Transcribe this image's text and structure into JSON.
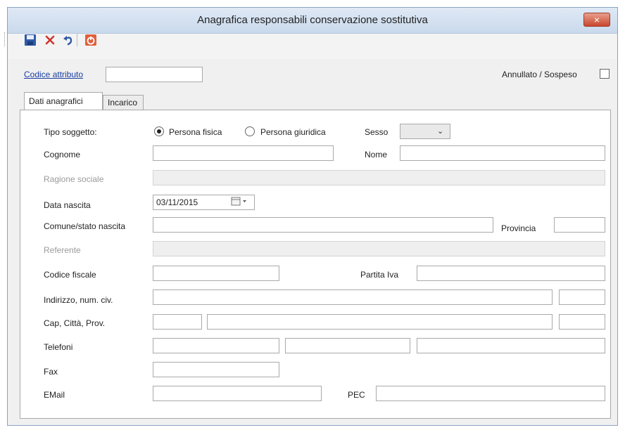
{
  "window": {
    "title": "Anagrafica responsabili conservazione sostitutiva",
    "close_label": "×"
  },
  "toolbar": {
    "icons": [
      "save-icon",
      "delete-icon",
      "undo-icon",
      "exit-icon"
    ]
  },
  "header": {
    "codice_attributo_label": "Codice attributo",
    "codice_attributo_value": "",
    "annullato_label": "Annullato / Sospeso",
    "annullato_checked": false
  },
  "tabs": {
    "items": [
      {
        "label": "Dati anagrafici",
        "active": true
      },
      {
        "label": "Incarico",
        "active": false
      }
    ]
  },
  "form": {
    "tipo_soggetto_label": "Tipo soggetto:",
    "radio_persona_fisica": "Persona fisica",
    "radio_persona_giuridica": "Persona giuridica",
    "selected_tipo": "Persona fisica",
    "sesso_label": "Sesso",
    "sesso_value": "",
    "cognome_label": "Cognome",
    "nome_label": "Nome",
    "ragione_sociale_label": "Ragione sociale",
    "data_nascita_label": "Data nascita",
    "data_nascita_value": "03/11/2015",
    "comune_label": "Comune/stato nascita",
    "provincia_label": "Provincia",
    "referente_label": "Referente",
    "codice_fiscale_label": "Codice fiscale",
    "partita_iva_label": "Partita Iva",
    "indirizzo_label": "Indirizzo, num. civ.",
    "cap_label": "Cap, Città, Prov.",
    "telefoni_label": "Telefoni",
    "fax_label": "Fax",
    "email_label": "EMail",
    "pec_label": "PEC"
  },
  "colors": {
    "link": "#1b3fa0",
    "disabled_text": "#9a9a9a",
    "close_button": "#c9472e"
  }
}
